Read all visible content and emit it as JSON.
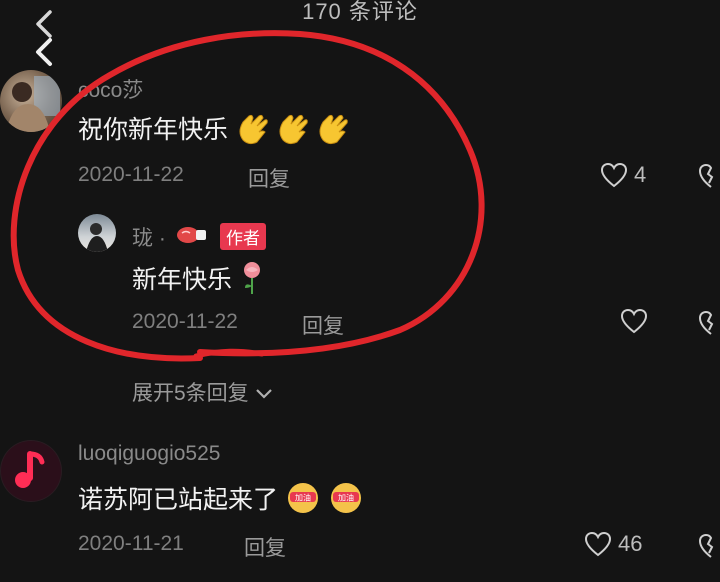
{
  "header": {
    "title": "170 条评论"
  },
  "comments": [
    {
      "username": "coco莎",
      "text": "祝你新年快乐",
      "date": "2020-11-22",
      "reply_label": "回复",
      "likes": "4"
    },
    {
      "username": "珑 ·",
      "badge": "作者",
      "text": "新年快乐",
      "date": "2020-11-22",
      "reply_label": "回复",
      "likes": ""
    },
    {
      "username": "luoqiguogio525",
      "text": "诺苏阿已站起来了",
      "date": "2020-11-21",
      "reply_label": "回复",
      "likes": "46"
    }
  ],
  "expand_replies": "展开5条回复",
  "colors": {
    "background": "#141414",
    "annotation_red": "#e0262b",
    "author_badge": "#e8384f",
    "music_pink": "#ff2d55"
  },
  "icons": [
    "back-icon",
    "heart-icon",
    "dislike-icon",
    "clap-emoji",
    "rose-emoji",
    "boxing-glove-icon",
    "jiayou-emoji",
    "music-note-icon",
    "chevron-down-icon"
  ]
}
